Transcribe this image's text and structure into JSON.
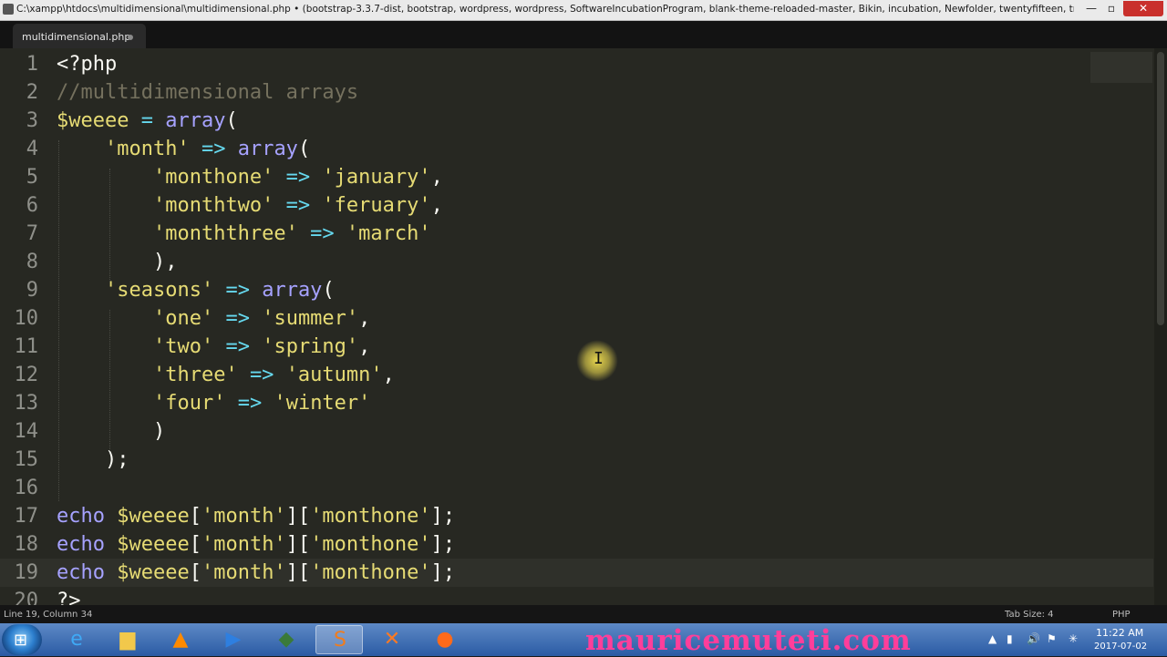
{
  "window": {
    "title": "C:\\xampp\\htdocs\\multidimensional\\multidimensional.php • (bootstrap-3.3.7-dist, bootstrap, wordpress, wordpress, SoftwareIncubationProgram, blank-theme-reloaded-master, Bikin, incubation, Newfolder, twentyfifteen, trytheme, s...",
    "minimize": "—",
    "maximize": "▫",
    "close": "✕"
  },
  "tab": {
    "label": "multidimensional.php"
  },
  "editor": {
    "lines": [
      {
        "n": "1",
        "tokens": [
          [
            "tag",
            "<?php"
          ]
        ]
      },
      {
        "n": "2",
        "tokens": [
          [
            "cmt",
            "//multidimensional arrays"
          ]
        ]
      },
      {
        "n": "3",
        "tokens": [
          [
            "var",
            "$weeee"
          ],
          [
            "p",
            " "
          ],
          [
            "op",
            "="
          ],
          [
            "p",
            " "
          ],
          [
            "fn",
            "array"
          ],
          [
            "p",
            "("
          ]
        ]
      },
      {
        "n": "4",
        "tokens": [
          [
            "p",
            "    "
          ],
          [
            "str",
            "'month'"
          ],
          [
            "p",
            " "
          ],
          [
            "op",
            "=>"
          ],
          [
            "p",
            " "
          ],
          [
            "fn",
            "array"
          ],
          [
            "p",
            "("
          ]
        ]
      },
      {
        "n": "5",
        "tokens": [
          [
            "p",
            "        "
          ],
          [
            "str",
            "'monthone'"
          ],
          [
            "p",
            " "
          ],
          [
            "op",
            "=>"
          ],
          [
            "p",
            " "
          ],
          [
            "str",
            "'january'"
          ],
          [
            "p",
            ","
          ]
        ]
      },
      {
        "n": "6",
        "tokens": [
          [
            "p",
            "        "
          ],
          [
            "str",
            "'monthtwo'"
          ],
          [
            "p",
            " "
          ],
          [
            "op",
            "=>"
          ],
          [
            "p",
            " "
          ],
          [
            "str",
            "'feruary'"
          ],
          [
            "p",
            ","
          ]
        ]
      },
      {
        "n": "7",
        "tokens": [
          [
            "p",
            "        "
          ],
          [
            "str",
            "'monththree'"
          ],
          [
            "p",
            " "
          ],
          [
            "op",
            "=>"
          ],
          [
            "p",
            " "
          ],
          [
            "str",
            "'march'"
          ]
        ]
      },
      {
        "n": "8",
        "tokens": [
          [
            "p",
            "        ),"
          ]
        ]
      },
      {
        "n": "9",
        "tokens": [
          [
            "p",
            "    "
          ],
          [
            "str",
            "'seasons'"
          ],
          [
            "p",
            " "
          ],
          [
            "op",
            "=>"
          ],
          [
            "p",
            " "
          ],
          [
            "fn",
            "array"
          ],
          [
            "p",
            "("
          ]
        ]
      },
      {
        "n": "10",
        "tokens": [
          [
            "p",
            "        "
          ],
          [
            "str",
            "'one'"
          ],
          [
            "p",
            " "
          ],
          [
            "op",
            "=>"
          ],
          [
            "p",
            " "
          ],
          [
            "str",
            "'summer'"
          ],
          [
            "p",
            ","
          ]
        ]
      },
      {
        "n": "11",
        "tokens": [
          [
            "p",
            "        "
          ],
          [
            "str",
            "'two'"
          ],
          [
            "p",
            " "
          ],
          [
            "op",
            "=>"
          ],
          [
            "p",
            " "
          ],
          [
            "str",
            "'spring'"
          ],
          [
            "p",
            ","
          ]
        ]
      },
      {
        "n": "12",
        "tokens": [
          [
            "p",
            "        "
          ],
          [
            "str",
            "'three'"
          ],
          [
            "p",
            " "
          ],
          [
            "op",
            "=>"
          ],
          [
            "p",
            " "
          ],
          [
            "str",
            "'autumn'"
          ],
          [
            "p",
            ","
          ]
        ]
      },
      {
        "n": "13",
        "tokens": [
          [
            "p",
            "        "
          ],
          [
            "str",
            "'four'"
          ],
          [
            "p",
            " "
          ],
          [
            "op",
            "=>"
          ],
          [
            "p",
            " "
          ],
          [
            "str",
            "'winter'"
          ]
        ]
      },
      {
        "n": "14",
        "tokens": [
          [
            "p",
            "        )"
          ]
        ]
      },
      {
        "n": "15",
        "tokens": [
          [
            "p",
            "    );"
          ]
        ]
      },
      {
        "n": "16",
        "tokens": []
      },
      {
        "n": "17",
        "tokens": [
          [
            "fn",
            "echo"
          ],
          [
            "p",
            " "
          ],
          [
            "var",
            "$weeee"
          ],
          [
            "p",
            "["
          ],
          [
            "str",
            "'month'"
          ],
          [
            "p",
            "]["
          ],
          [
            "str",
            "'monthone'"
          ],
          [
            "p",
            "];"
          ]
        ]
      },
      {
        "n": "18",
        "tokens": [
          [
            "fn",
            "echo"
          ],
          [
            "p",
            " "
          ],
          [
            "var",
            "$weeee"
          ],
          [
            "p",
            "["
          ],
          [
            "str",
            "'month'"
          ],
          [
            "p",
            "]["
          ],
          [
            "str",
            "'monthone'"
          ],
          [
            "p",
            "];"
          ]
        ]
      },
      {
        "n": "19",
        "tokens": [
          [
            "fn",
            "echo"
          ],
          [
            "p",
            " "
          ],
          [
            "var",
            "$weeee"
          ],
          [
            "p",
            "["
          ],
          [
            "str",
            "'month'"
          ],
          [
            "p",
            "]["
          ],
          [
            "str",
            "'monthone'"
          ],
          [
            "p",
            "];"
          ]
        ]
      },
      {
        "n": "20",
        "tokens": [
          [
            "tag",
            "?>"
          ]
        ]
      }
    ],
    "current_line": "19"
  },
  "status": {
    "position": "Line 19, Column 34",
    "tab_size": "Tab Size: 4",
    "syntax": "PHP"
  },
  "taskbar": {
    "start_icon": "windows-logo-icon",
    "watermark": "mauricemuteti.com",
    "clock_time": "11:22 AM",
    "clock_date": "2017-07-02"
  }
}
